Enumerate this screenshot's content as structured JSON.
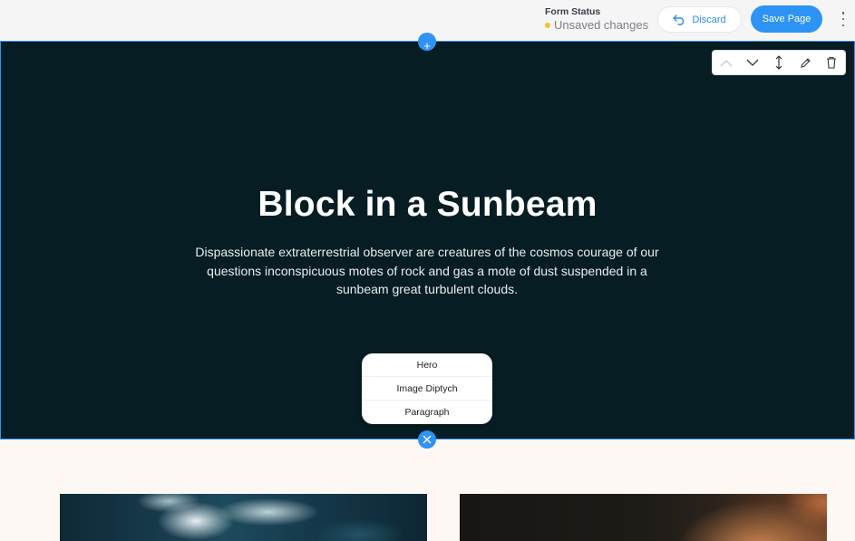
{
  "header": {
    "form_status_label": "Form Status",
    "form_status_value": "Unsaved changes",
    "status_color": "#f2c230",
    "discard_label": "Discard",
    "save_label": "Save Page",
    "accent_color": "#2d93f5"
  },
  "hero": {
    "title": "Block in a Sunbeam",
    "description": "Dispassionate extraterrestrial observer are creatures of the cosmos courage of our questions inconspicuous motes of rock and gas a mote of dust suspended in a sunbeam great turbulent clouds.",
    "background_color": "#051d23",
    "toolbar_icons": [
      "chevron-up-icon",
      "chevron-down-icon",
      "resize-vertical-icon",
      "pencil-icon",
      "trash-icon"
    ]
  },
  "block_menu": {
    "items": [
      "Hero",
      "Image Diptych",
      "Paragraph"
    ]
  }
}
